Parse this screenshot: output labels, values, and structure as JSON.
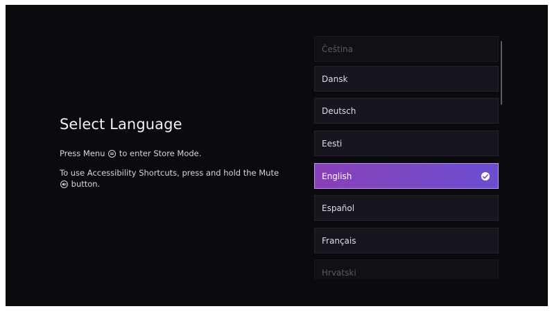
{
  "title": "Select Language",
  "instructions": {
    "store_mode_before": "Press Menu",
    "store_mode_after": "to enter Store Mode.",
    "accessibility_before": "To use Accessibility Shortcuts, press and hold the Mute",
    "accessibility_after": "button."
  },
  "languages": [
    {
      "label": "Čeština",
      "state": "faded"
    },
    {
      "label": "Dansk",
      "state": "normal"
    },
    {
      "label": "Deutsch",
      "state": "normal"
    },
    {
      "label": "Eesti",
      "state": "normal"
    },
    {
      "label": "English",
      "state": "selected"
    },
    {
      "label": "Español",
      "state": "normal"
    },
    {
      "label": "Français",
      "state": "normal"
    },
    {
      "label": "Hrvatski",
      "state": "faded"
    }
  ],
  "colors": {
    "background": "#0b0b0f",
    "selected_start": "#8a40b6",
    "selected_end": "#6a4ed0",
    "item_background": "#16161f"
  },
  "icons": {
    "menu": "menu-button-icon",
    "mute": "mute-button-icon",
    "selected": "checkmark-circle-icon"
  }
}
